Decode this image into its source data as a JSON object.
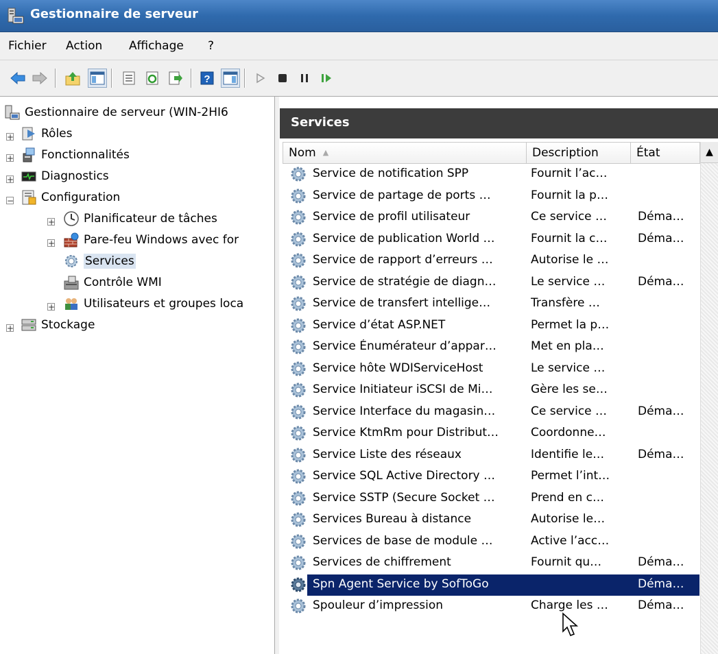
{
  "window": {
    "title": "Gestionnaire de serveur"
  },
  "menu": {
    "items": [
      "Fichier",
      "Action",
      "Affichage",
      "?"
    ]
  },
  "toolbar": {
    "buttons": [
      "back-icon",
      "forward-icon",
      "up-folder-icon",
      "show-tree-icon",
      "properties-icon",
      "refresh-icon",
      "export-icon",
      "help-icon",
      "action-pane-icon",
      "start-icon",
      "stop-icon",
      "pause-icon",
      "restart-icon"
    ]
  },
  "tree": {
    "root": "Gestionnaire de serveur (WIN-2HI6",
    "items": [
      {
        "label": "Rôles",
        "icon": "roles-icon",
        "expander": "+"
      },
      {
        "label": "Fonctionnalités",
        "icon": "features-icon",
        "expander": "+"
      },
      {
        "label": "Diagnostics",
        "icon": "diagnostics-icon",
        "expander": "+"
      },
      {
        "label": "Configuration",
        "icon": "configuration-icon",
        "expander": "−"
      },
      {
        "label": "Planificateur de tâches",
        "icon": "clock-icon",
        "expander": "+"
      },
      {
        "label": "Pare-feu Windows avec for",
        "icon": "firewall-icon",
        "expander": "+"
      },
      {
        "label": "Services",
        "icon": "gear-icon",
        "expander": ""
      },
      {
        "label": "Contrôle WMI",
        "icon": "wmi-icon",
        "expander": ""
      },
      {
        "label": "Utilisateurs et groupes loca",
        "icon": "users-icon",
        "expander": "+"
      },
      {
        "label": "Stockage",
        "icon": "storage-icon",
        "expander": "+"
      }
    ]
  },
  "panel": {
    "title": "Services"
  },
  "columns": {
    "name": "Nom",
    "description": "Description",
    "state": "État"
  },
  "rows": [
    {
      "name": "Service de notification SPP",
      "description": "Fournit l’ac…",
      "state": ""
    },
    {
      "name": "Service de partage de ports …",
      "description": "Fournit la p…",
      "state": ""
    },
    {
      "name": "Service de profil utilisateur",
      "description": "Ce service …",
      "state": "Déma…"
    },
    {
      "name": "Service de publication World …",
      "description": "Fournit la c…",
      "state": "Déma…"
    },
    {
      "name": "Service de rapport d’erreurs …",
      "description": "Autorise le …",
      "state": ""
    },
    {
      "name": "Service de stratégie de diagn…",
      "description": "Le service …",
      "state": "Déma…"
    },
    {
      "name": "Service de transfert intellige…",
      "description": "Transfère …",
      "state": ""
    },
    {
      "name": "Service d’état ASP.NET",
      "description": "Permet la p…",
      "state": ""
    },
    {
      "name": "Service Énumérateur d’appar…",
      "description": "Met en pla…",
      "state": ""
    },
    {
      "name": "Service hôte WDIServiceHost",
      "description": "Le service …",
      "state": ""
    },
    {
      "name": "Service Initiateur iSCSI de Mi…",
      "description": "Gère les se…",
      "state": ""
    },
    {
      "name": "Service Interface du magasin…",
      "description": "Ce service …",
      "state": "Déma…"
    },
    {
      "name": "Service KtmRm pour Distribut…",
      "description": "Coordonne…",
      "state": ""
    },
    {
      "name": "Service Liste des réseaux",
      "description": "Identifie le…",
      "state": "Déma…"
    },
    {
      "name": "Service SQL Active Directory …",
      "description": "Permet l’int…",
      "state": ""
    },
    {
      "name": "Service SSTP (Secure Socket …",
      "description": "Prend en c…",
      "state": ""
    },
    {
      "name": "Services Bureau à distance",
      "description": "Autorise le…",
      "state": ""
    },
    {
      "name": "Services de base de module …",
      "description": "Active l’acc…",
      "state": ""
    },
    {
      "name": "Services de chiffrement",
      "description": "Fournit qu…",
      "state": "Déma…"
    },
    {
      "name": "Spn Agent Service by SofToGo",
      "description": "",
      "state": "Déma…",
      "selected": true
    },
    {
      "name": "Spouleur d’impression",
      "description": "Charge les …",
      "state": "Déma…"
    }
  ],
  "colors": {
    "titlebar": "#2f6aad",
    "panel_header": "#3c3c3c",
    "selection": "#0a246a"
  }
}
